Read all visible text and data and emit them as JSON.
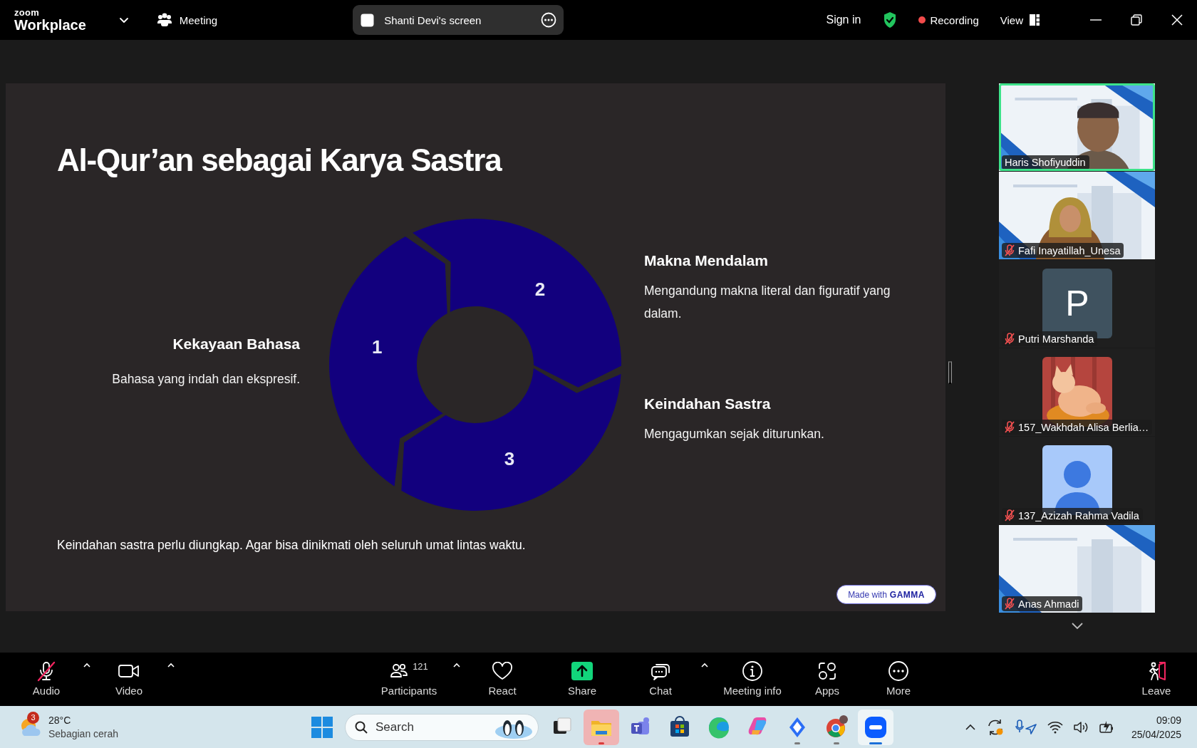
{
  "topbar": {
    "brand_small": "zoom",
    "brand": "Workplace",
    "meeting": "Meeting",
    "share_title": "Shanti Devi's screen",
    "sign_in": "Sign in",
    "recording": "Recording",
    "view": "View"
  },
  "slide": {
    "title": "Al-Qur’an sebagai Karya Sastra",
    "segments": [
      {
        "number": "1"
      },
      {
        "number": "2"
      },
      {
        "number": "3"
      }
    ],
    "points": [
      {
        "heading": "Kekayaan Bahasa",
        "text": "Bahasa yang indah dan ekspresif."
      },
      {
        "heading": "Makna Mendalam",
        "text": "Mengandung makna literal dan figuratif yang dalam."
      },
      {
        "heading": "Keindahan Sastra",
        "text": "Mengagumkan sejak diturunkan."
      }
    ],
    "footer": "Keindahan sastra perlu diungkap. Agar bisa dinikmati oleh seluruh umat lintas waktu.",
    "badge_prefix": "Made with",
    "badge_brand": "GAMMA"
  },
  "participants": [
    {
      "name": "Haris Shofiyuddin",
      "kind": "video",
      "muted": false,
      "speaking": true
    },
    {
      "name": "Fafi Inayatillah_Unesa",
      "kind": "video",
      "muted": true,
      "speaking": false
    },
    {
      "name": "Putri Marshanda",
      "kind": "letter",
      "letter": "P",
      "muted": true,
      "speaking": false
    },
    {
      "name": "157_Wakhdah Alisa Berlia…",
      "muted": true,
      "speaking": false
    },
    {
      "name": "137_Azizah Rahma Vadila",
      "kind": "avatar",
      "muted": true,
      "speaking": false
    },
    {
      "name": "Anas Ahmadi",
      "kind": "video",
      "muted": true,
      "speaking": false
    }
  ],
  "toolbar": [
    {
      "label": "Audio",
      "kind": "mic",
      "muted": true,
      "menu": true
    },
    {
      "label": "Video",
      "kind": "camera",
      "muted": false,
      "menu": true
    },
    {
      "label": "Participants",
      "kind": "people",
      "count": "121",
      "muted": false,
      "menu": true
    },
    {
      "label": "React",
      "kind": "heart",
      "muted": false,
      "menu": false
    },
    {
      "label": "Share",
      "kind": "share",
      "muted": false,
      "menu": false
    },
    {
      "label": "Chat",
      "kind": "chat",
      "muted": false,
      "menu": true
    },
    {
      "label": "Meeting info",
      "kind": "info",
      "muted": false,
      "menu": false
    },
    {
      "label": "Apps",
      "kind": "apps",
      "muted": false,
      "menu": false
    },
    {
      "label": "More",
      "kind": "more",
      "muted": false,
      "menu": false
    },
    {
      "label": "Leave",
      "kind": "leave",
      "muted": false,
      "menu": false
    }
  ],
  "taskbar": {
    "weather": {
      "badge": "3",
      "temp": "28°C",
      "text": "Sebagian cerah"
    },
    "search": {
      "placeholder": "Search"
    },
    "apps": [
      {
        "kind": "taskview",
        "running": false,
        "alert": false,
        "selected": false
      },
      {
        "kind": "explorer",
        "running": true,
        "alert": true,
        "selected": false
      },
      {
        "kind": "teams",
        "running": false,
        "alert": false,
        "selected": false
      },
      {
        "kind": "store",
        "running": false,
        "alert": false,
        "selected": false
      },
      {
        "kind": "edge",
        "running": false,
        "alert": false,
        "selected": false
      },
      {
        "kind": "copilot",
        "running": false,
        "alert": false,
        "selected": false
      },
      {
        "kind": "diamond",
        "running": true,
        "alert": false,
        "selected": false
      },
      {
        "kind": "chrome",
        "running": true,
        "alert": false,
        "selected": false
      },
      {
        "kind": "zoom",
        "running": true,
        "alert": false,
        "selected": true
      }
    ],
    "time": "09:09",
    "date": "25/04/2025"
  }
}
